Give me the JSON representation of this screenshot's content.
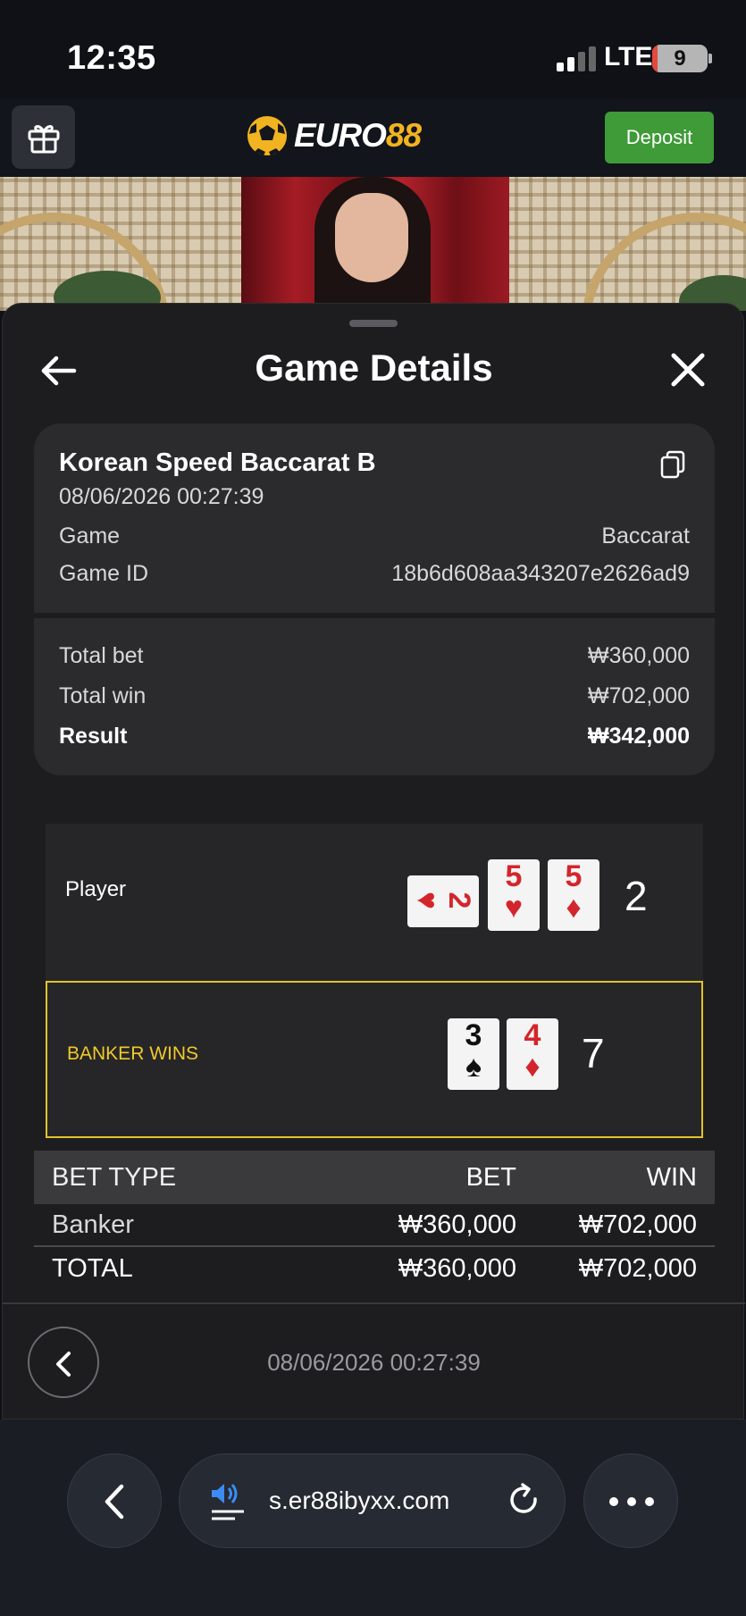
{
  "status_bar": {
    "time": "12:35",
    "network": "LTE",
    "battery": "9"
  },
  "app_header": {
    "brand_prefix": "EURO",
    "brand_suffix": "88",
    "deposit_label": "Deposit"
  },
  "sheet": {
    "title": "Game Details",
    "game": {
      "name": "Korean Speed Baccarat B",
      "datetime": "08/06/2026 00:27:39",
      "game_label": "Game",
      "game_value": "Baccarat",
      "game_id_label": "Game ID",
      "game_id_value": "18b6d608aa343207e2626ad9"
    },
    "summary": {
      "total_bet_label": "Total bet",
      "total_bet_value": "₩360,000",
      "total_win_label": "Total win",
      "total_win_value": "₩702,000",
      "result_label": "Result",
      "result_value": "₩342,000"
    },
    "board": {
      "player": {
        "label": "Player",
        "score": "2",
        "cards": [
          {
            "rank": "2",
            "suit": "♥",
            "color": "red"
          },
          {
            "rank": "5",
            "suit": "♥",
            "color": "red"
          },
          {
            "rank": "5",
            "suit": "♦",
            "color": "red"
          }
        ]
      },
      "banker": {
        "label": "BANKER WINS",
        "score": "7",
        "cards": [
          {
            "rank": "3",
            "suit": "♠",
            "color": "black"
          },
          {
            "rank": "4",
            "suit": "♦",
            "color": "red"
          }
        ]
      },
      "highlight_color": "#e3c22c"
    },
    "bets_table": {
      "headers": [
        "BET TYPE",
        "BET",
        "WIN"
      ],
      "rows": [
        [
          "Banker",
          "₩360,000",
          "₩702,000"
        ],
        [
          "TOTAL",
          "₩360,000",
          "₩702,000"
        ]
      ]
    },
    "footer_date": "08/06/2026 00:27:39"
  },
  "browser": {
    "url": "s.er88ibyxx.com"
  },
  "colors": {
    "accent_gold": "#f2b320",
    "deposit_green": "#3e9b37",
    "card_red": "#d3262c"
  }
}
